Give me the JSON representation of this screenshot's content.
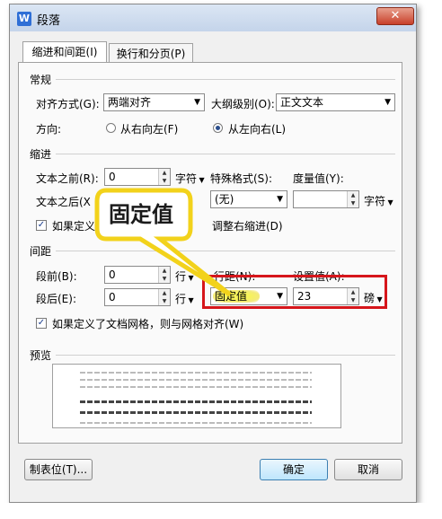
{
  "window": {
    "title": "段落",
    "app_icon": "W",
    "close_glyph": "✕"
  },
  "tabs": [
    {
      "label": "缩进和间距(I)",
      "active": true
    },
    {
      "label": "换行和分页(P)",
      "active": false
    }
  ],
  "general": {
    "section_label": "常规",
    "alignment_label": "对齐方式(G):",
    "alignment_value": "两端对齐",
    "outline_label": "大纲级别(O):",
    "outline_value": "正文文本",
    "direction_label": "方向:",
    "rtl_label": "从右向左(F)",
    "ltr_label": "从左向右(L)",
    "direction_selected": "ltr"
  },
  "indent": {
    "section_label": "缩进",
    "before_label": "文本之前(R):",
    "before_value": "0",
    "before_unit": "字符",
    "after_label": "文本之后(X",
    "special_label": "特殊格式(S):",
    "special_value": "(无)",
    "measure_label": "度量值(Y):",
    "measure_value": "",
    "measure_unit": "字符",
    "auto_adjust_prefix": "如果定义了",
    "auto_adjust_suffix": "调整右缩进(D)",
    "auto_adjust_checked": true
  },
  "spacing": {
    "section_label": "间距",
    "before_label": "段前(B):",
    "before_value": "0",
    "before_unit": "行",
    "after_label": "段后(E):",
    "after_value": "0",
    "after_unit": "行",
    "line_spacing_label": "行距(N):",
    "line_spacing_value": "固定值",
    "setting_label": "设置值(A):",
    "setting_value": "23",
    "setting_unit": "磅",
    "grid_align_label": "如果定义了文档网格，则与网格对齐(W)",
    "grid_align_checked": true
  },
  "preview": {
    "section_label": "预览"
  },
  "callout": {
    "text": "固定值"
  },
  "buttons": {
    "tabs_button": "制表位(T)...",
    "ok": "确定",
    "cancel": "取消"
  },
  "colors": {
    "highlight_red": "#d6161b",
    "callout_yellow": "#f2d21b",
    "marker_yellow": "#f7f35a"
  }
}
